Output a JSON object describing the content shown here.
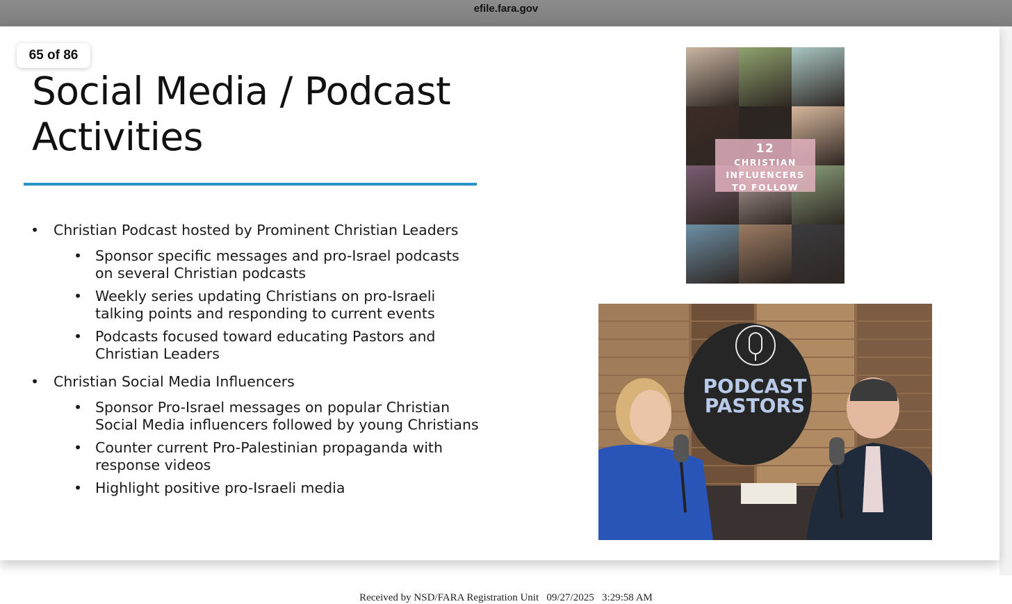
{
  "browser": {
    "url": "efile.fara.gov"
  },
  "viewer": {
    "page_indicator": "65 of 86"
  },
  "slide": {
    "title_line1": "Social Media / Podcast",
    "title_line2": "Activities",
    "bullet_char": "•",
    "sections": [
      {
        "heading": "Christian Podcast hosted by Prominent Christian Leaders",
        "items": [
          [
            "Sponsor specific messages and pro-Israel podcasts",
            "on several Christian podcasts"
          ],
          [
            "Weekly series updating Christians on pro-Israeli",
            "talking points and responding to current events"
          ],
          [
            "Podcasts focused toward educating Pastors and",
            "Christian Leaders"
          ]
        ]
      },
      {
        "heading": "Christian Social Media Influencers",
        "items": [
          [
            "Sponsor Pro-Israel messages on popular Christian",
            "Social Media influencers followed by young Christians"
          ],
          [
            "Counter current Pro-Palestinian propaganda with",
            "response videos"
          ],
          [
            "Highlight positive pro-Israeli media"
          ]
        ]
      }
    ],
    "collage": {
      "number": "12",
      "line1": "CHRISTIAN",
      "line2": "INFLUENCERS",
      "line3": "TO FOLLOW",
      "colors": [
        "#c9b6a3",
        "#8fa36e",
        "#a9c6c4",
        "#3d2c26",
        "#2b2522",
        "#d7b79c",
        "#7a5d72",
        "#b9a7a2",
        "#8aa07a",
        "#6c8fa5",
        "#9b7b62",
        "#3b3b3f"
      ]
    },
    "podcast_image": {
      "logo_line1": "PODCAST",
      "logo_line2": "PASTORS"
    }
  },
  "footer": {
    "received": "Received by NSD/FARA Registration Unit   09/27/2025   3:29:58 AM"
  }
}
